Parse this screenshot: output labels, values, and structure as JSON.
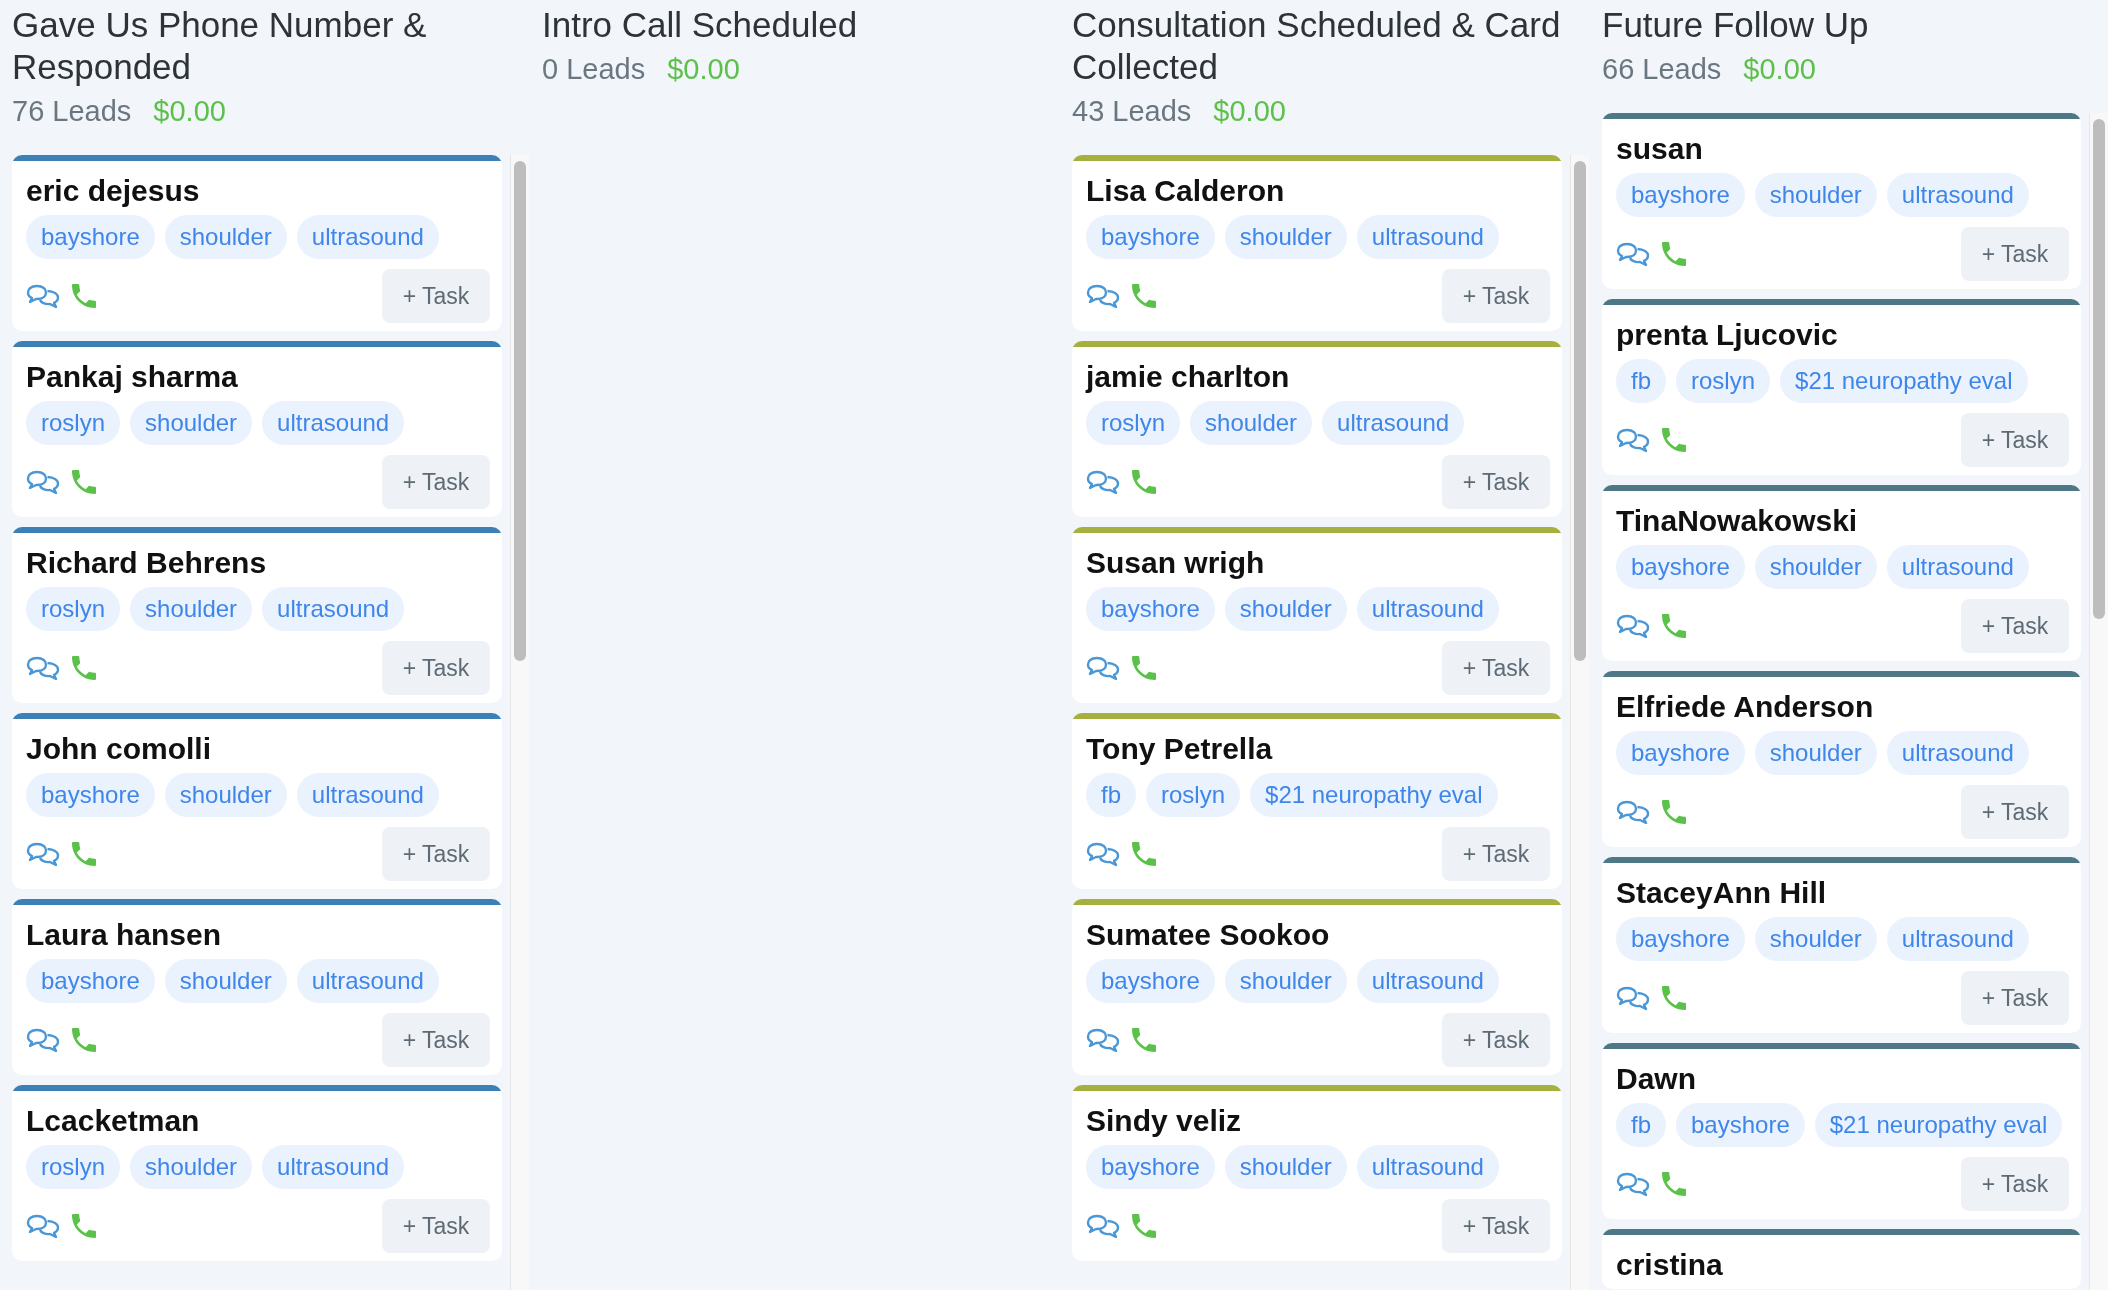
{
  "columns": [
    {
      "title": "Gave Us Phone Number & Responded",
      "leads": "76 Leads",
      "amount": "$0.00",
      "color": "#3d80b5",
      "cards": [
        {
          "name": "eric dejesus",
          "tags": [
            "bayshore",
            "shoulder",
            "ultrasound"
          ],
          "task_button": "+ Task"
        },
        {
          "name": "Pankaj sharma",
          "tags": [
            "roslyn",
            "shoulder",
            "ultrasound"
          ],
          "task_button": "+ Task"
        },
        {
          "name": "Richard Behrens",
          "tags": [
            "roslyn",
            "shoulder",
            "ultrasound"
          ],
          "task_button": "+ Task"
        },
        {
          "name": "John comolli",
          "tags": [
            "bayshore",
            "shoulder",
            "ultrasound"
          ],
          "task_button": "+ Task"
        },
        {
          "name": "Laura hansen",
          "tags": [
            "bayshore",
            "shoulder",
            "ultrasound"
          ],
          "task_button": "+ Task"
        },
        {
          "name": "Lcacketman",
          "tags": [
            "roslyn",
            "shoulder",
            "ultrasound"
          ],
          "task_button": "+ Task"
        }
      ]
    },
    {
      "title": "Intro Call Scheduled",
      "leads": "0 Leads",
      "amount": "$0.00"
    },
    {
      "title": "Consultation Scheduled & Card Collected",
      "leads": "43 Leads",
      "amount": "$0.00",
      "color": "#a6b03f",
      "cards": [
        {
          "name": "Lisa Calderon",
          "tags": [
            "bayshore",
            "shoulder",
            "ultrasound"
          ],
          "task_button": "+ Task"
        },
        {
          "name": "jamie charlton",
          "tags": [
            "roslyn",
            "shoulder",
            "ultrasound"
          ],
          "task_button": "+ Task"
        },
        {
          "name": "Susan wrigh",
          "tags": [
            "bayshore",
            "shoulder",
            "ultrasound"
          ],
          "task_button": "+ Task"
        },
        {
          "name": "Tony Petrella",
          "tags": [
            "fb",
            "roslyn",
            "$21 neuropathy eval"
          ],
          "task_button": "+ Task"
        },
        {
          "name": "Sumatee Sookoo",
          "tags": [
            "bayshore",
            "shoulder",
            "ultrasound"
          ],
          "task_button": "+ Task"
        },
        {
          "name": "Sindy veliz",
          "tags": [
            "bayshore",
            "shoulder",
            "ultrasound"
          ],
          "task_button": "+ Task"
        }
      ]
    },
    {
      "title": "Future Follow Up",
      "leads": "66 Leads",
      "amount": "$0.00",
      "color": "#4f7886",
      "cards": [
        {
          "name": "susan",
          "tags": [
            "bayshore",
            "shoulder",
            "ultrasound"
          ],
          "task_button": "+ Task"
        },
        {
          "name": "prenta Ljucovic",
          "tags": [
            "fb",
            "roslyn",
            "$21 neuropathy eval"
          ],
          "task_button": "+ Task"
        },
        {
          "name": "TinaNowakowski",
          "tags": [
            "bayshore",
            "shoulder",
            "ultrasound"
          ],
          "task_button": "+ Task"
        },
        {
          "name": "Elfriede Anderson",
          "tags": [
            "bayshore",
            "shoulder",
            "ultrasound"
          ],
          "task_button": "+ Task"
        },
        {
          "name": "StaceyAnn Hill",
          "tags": [
            "bayshore",
            "shoulder",
            "ultrasound"
          ],
          "task_button": "+ Task"
        },
        {
          "name": "Dawn",
          "tags": [
            "fb",
            "bayshore",
            "$21 neuropathy eval"
          ],
          "task_button": "+ Task"
        },
        {
          "name": "cristina"
        }
      ]
    }
  ]
}
